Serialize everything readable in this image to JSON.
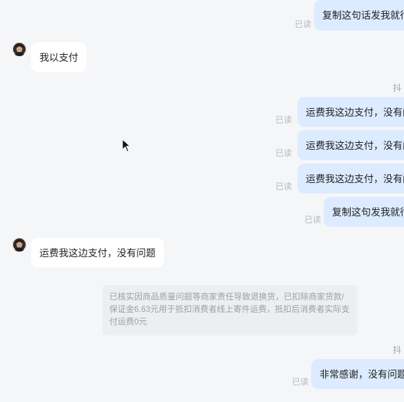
{
  "chat": {
    "read_label": "已读",
    "sender_name_partial": "抖",
    "messages": [
      {
        "side": "right",
        "text": "复制这句话发我就行"
      },
      {
        "side": "left",
        "text": "我以支付"
      },
      {
        "side": "right",
        "text": "运费我这边支付，没有问题"
      },
      {
        "side": "right",
        "text": "运费我这边支付，没有问题"
      },
      {
        "side": "right",
        "text": "运费我这边支付，没有问题"
      },
      {
        "side": "right",
        "text": "复制这句发我就行"
      },
      {
        "side": "left",
        "text": "运费我这边支付，没有问题"
      },
      {
        "side": "system",
        "text": "已核实因商品质量问题等商家责任导致退换货，已扣除商家货款/保证金6.63元用于抵扣消费者线上寄件运费，抵扣后消费者实际支付运费0元"
      },
      {
        "side": "right",
        "text": "非常感谢，没有问题"
      }
    ]
  }
}
